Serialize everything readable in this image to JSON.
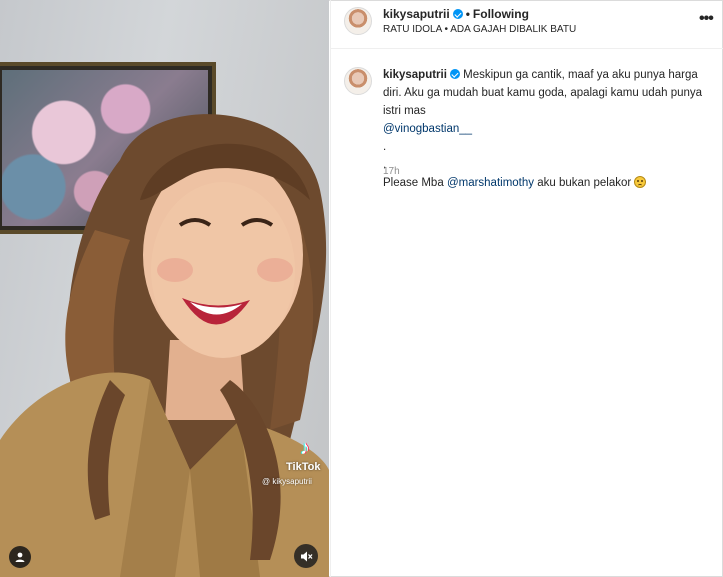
{
  "post": {
    "username": "kikysaputrii",
    "following_label": "Following",
    "audio_label": "RATU IDOLA • ADA GAJAH DIBALIK BATU",
    "more_label": "•••"
  },
  "caption": {
    "username": "kikysaputrii",
    "line1": "Meskipun ga cantik, maaf ya aku punya harga diri.",
    "line2": "Aku ga mudah buat kamu goda, apalagi kamu udah punya istri mas",
    "mention1": "@vinogbastian__",
    "dot1": ".",
    "dot2": ".",
    "line3_prefix": "Please Mba",
    "mention2": "@marshatimothy",
    "line3_suffix": "aku bukan pelakor",
    "emoji": "slightly-frowning-face",
    "timestamp": "17h"
  },
  "video": {
    "watermark_brand": "TikTok",
    "watermark_user": "@ kikysaputrii",
    "icons": [
      "tiktok-icon",
      "user-tag-icon",
      "muted-speaker-icon"
    ]
  },
  "colors": {
    "verified_blue": "#0095f6",
    "mention_blue": "#00376b",
    "secondary_text": "#8e8e8e",
    "border": "#dbdbdb"
  }
}
